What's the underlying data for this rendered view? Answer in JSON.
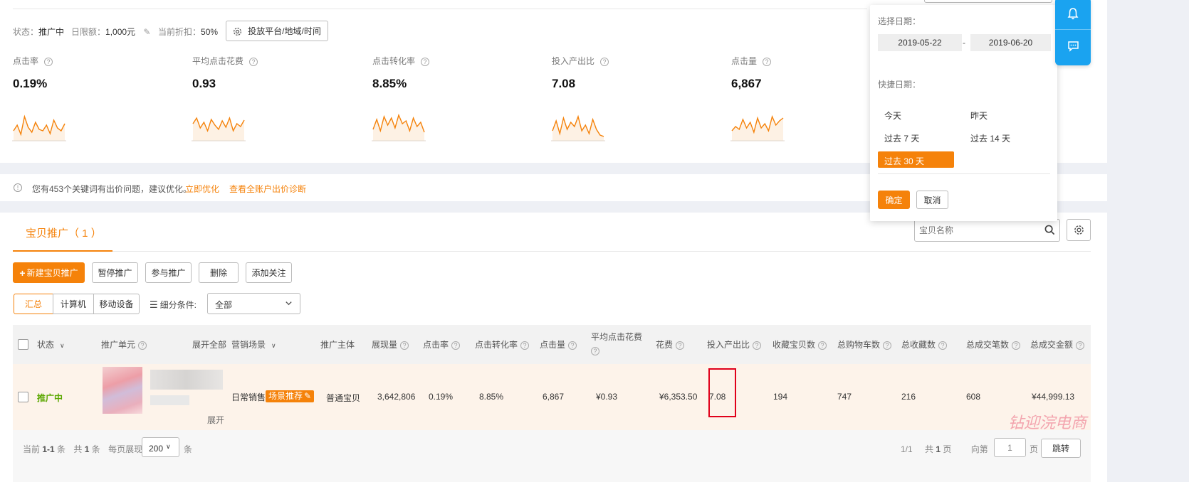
{
  "status_bar": {
    "status_label": "状态：",
    "status_value": "推广中",
    "daily_limit_label": "日限额：",
    "daily_limit_value": "1,000元",
    "discount_label": "当前折扣：",
    "discount_value": "50%",
    "platform_button": "投放平台/地域/时间"
  },
  "metrics": [
    {
      "label": "点击率",
      "value": "0.19%",
      "spark": [
        30,
        22,
        35,
        10,
        25,
        32,
        18,
        28,
        30,
        22,
        34,
        15,
        26,
        30,
        20
      ]
    },
    {
      "label": "平均点击花费",
      "value": "0.93",
      "spark": [
        20,
        12,
        26,
        18,
        30,
        14,
        22,
        28,
        16,
        25,
        12,
        30,
        20,
        24,
        15
      ]
    },
    {
      "label": "点击转化率",
      "value": "8.85%",
      "spark": [
        28,
        14,
        30,
        10,
        22,
        12,
        26,
        8,
        20,
        16,
        30,
        12,
        24,
        18,
        32
      ]
    },
    {
      "label": "投入产出比",
      "value": "7.08",
      "spark": [
        30,
        16,
        34,
        12,
        28,
        18,
        24,
        10,
        30,
        22,
        34,
        14,
        28,
        36,
        38
      ]
    },
    {
      "label": "点击量",
      "value": "6,867",
      "spark": [
        30,
        24,
        28,
        14,
        26,
        18,
        32,
        12,
        26,
        20,
        30,
        10,
        22,
        16,
        12
      ]
    }
  ],
  "notice": {
    "text": "您有453个关键词有出价问题，建议优化。",
    "link_optimize": "立即优化",
    "link_diagnose": "查看全账户出价诊断"
  },
  "tab": {
    "label": "宝贝推广（ 1 ）"
  },
  "search": {
    "placeholder": "宝贝名称"
  },
  "toolbar": {
    "new_button": "新建宝贝推广",
    "pause_button": "暂停推广",
    "join_button": "参与推广",
    "delete_button": "删除",
    "follow_button": "添加关注"
  },
  "device_tabs": [
    "汇总",
    "计算机",
    "移动设备"
  ],
  "filter": {
    "label": "细分条件:",
    "value": "全部"
  },
  "table": {
    "headers": {
      "status": "状态",
      "unit": "推广单元",
      "expand_all": "展开全部",
      "scene": "营销场景",
      "subject": "推广主体",
      "impressions": "展现量",
      "ctr": "点击率",
      "cvr": "点击转化率",
      "clicks": "点击量",
      "cpc": "平均点击花费",
      "cost": "花费",
      "roi": "投入产出比",
      "fav_items": "收藏宝贝数",
      "cart": "总购物车数",
      "fav_total": "总收藏数",
      "orders": "总成交笔数",
      "gmv": "总成交金额"
    },
    "row": {
      "status": "推广中",
      "scene": "日常销售",
      "scene_tag": "场景推荐",
      "subject": "普通宝贝",
      "impressions": "3,642,806",
      "ctr": "0.19%",
      "cvr": "8.85%",
      "clicks": "6,867",
      "cpc": "¥0.93",
      "cost": "¥6,353.50",
      "roi": "7.08",
      "fav_items": "194",
      "cart": "747",
      "fav_total": "216",
      "orders": "608",
      "gmv": "¥44,999.13",
      "expand": "展开"
    }
  },
  "pagination": {
    "current_prefix": "当前",
    "current_range": "1-1",
    "item_unit": "条",
    "total_prefix": "共",
    "total_count": "1",
    "per_page_label": "每页展现",
    "per_page_value": "200",
    "page_indicator": "1/1",
    "total_pages_prefix": "共",
    "total_pages": "1",
    "pages_unit": "页",
    "goto_label": "向第",
    "goto_value": "1",
    "goto_unit": "页",
    "jump_button": "跳转"
  },
  "date_picker": {
    "select_label": "选择日期：",
    "start_date": "2019-05-22",
    "separator": "-",
    "end_date": "2019-06-20",
    "quick_label": "快捷日期：",
    "quick": [
      "今天",
      "昨天",
      "过去 7 天",
      "过去 14 天",
      "过去 30 天"
    ],
    "confirm": "确定",
    "cancel": "取消"
  },
  "watermark": "钻迎浣电商",
  "colors": {
    "accent": "#f5820a",
    "float_blue": "#1aa3f0",
    "status_green": "#5aa700",
    "highlight_red": "#e0001a"
  }
}
